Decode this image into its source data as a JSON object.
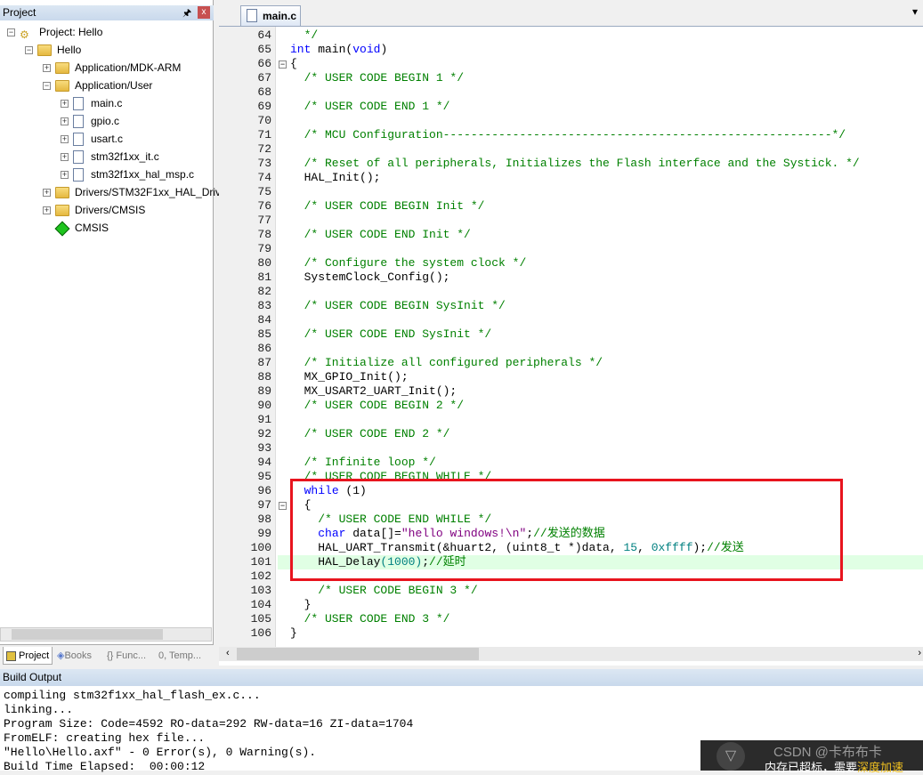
{
  "project_panel": {
    "title": "Project",
    "pin_icon": "pin-icon",
    "close_label": "x",
    "tree": [
      {
        "label": "Project: Hello",
        "level": 0,
        "icon": "project-icon",
        "expanded": true
      },
      {
        "label": "Hello",
        "level": 1,
        "icon": "folder-open-icon",
        "expanded": true
      },
      {
        "label": "Application/MDK-ARM",
        "level": 2,
        "icon": "folder-icon",
        "expanded": false
      },
      {
        "label": "Application/User",
        "level": 2,
        "icon": "folder-open-icon",
        "expanded": true
      },
      {
        "label": "main.c",
        "level": 3,
        "icon": "file-icon",
        "expanded": false
      },
      {
        "label": "gpio.c",
        "level": 3,
        "icon": "file-icon",
        "expanded": false
      },
      {
        "label": "usart.c",
        "level": 3,
        "icon": "file-icon",
        "expanded": false
      },
      {
        "label": "stm32f1xx_it.c",
        "level": 3,
        "icon": "file-icon",
        "expanded": false
      },
      {
        "label": "stm32f1xx_hal_msp.c",
        "level": 3,
        "icon": "file-icon",
        "expanded": false
      },
      {
        "label": "Drivers/STM32F1xx_HAL_Driver",
        "level": 2,
        "icon": "folder-icon",
        "expanded": false
      },
      {
        "label": "Drivers/CMSIS",
        "level": 2,
        "icon": "folder-icon",
        "expanded": false
      },
      {
        "label": "CMSIS",
        "level": 2,
        "icon": "cmsis-gem-icon",
        "expanded": null
      }
    ],
    "bottom_tabs": [
      {
        "label": "Project",
        "active": true
      },
      {
        "label": "Books"
      },
      {
        "label": "{} Func..."
      },
      {
        "label": "0, Temp..."
      }
    ]
  },
  "editor": {
    "tab": "main.c",
    "highlight_line": 101,
    "lines": [
      {
        "n": 64,
        "t": [
          [
            "cm",
            "  */"
          ]
        ]
      },
      {
        "n": 65,
        "t": [
          [
            "kw",
            "int"
          ],
          [
            "tx",
            " main("
          ],
          [
            "kw",
            "void"
          ],
          [
            "tx",
            ")"
          ]
        ]
      },
      {
        "n": 66,
        "fold": true,
        "t": [
          [
            "tx",
            "{"
          ]
        ]
      },
      {
        "n": 67,
        "t": [
          [
            "cm",
            "  /* USER CODE BEGIN 1 */"
          ]
        ]
      },
      {
        "n": 68,
        "t": []
      },
      {
        "n": 69,
        "t": [
          [
            "cm",
            "  /* USER CODE END 1 */"
          ]
        ]
      },
      {
        "n": 70,
        "t": []
      },
      {
        "n": 71,
        "t": [
          [
            "cm",
            "  /* MCU Configuration--------------------------------------------------------*/"
          ]
        ]
      },
      {
        "n": 72,
        "t": []
      },
      {
        "n": 73,
        "t": [
          [
            "cm",
            "  /* Reset of all peripherals, Initializes the Flash interface and the Systick. */"
          ]
        ]
      },
      {
        "n": 74,
        "t": [
          [
            "tx",
            "  HAL_Init();"
          ]
        ]
      },
      {
        "n": 75,
        "t": []
      },
      {
        "n": 76,
        "t": [
          [
            "cm",
            "  /* USER CODE BEGIN Init */"
          ]
        ]
      },
      {
        "n": 77,
        "t": []
      },
      {
        "n": 78,
        "t": [
          [
            "cm",
            "  /* USER CODE END Init */"
          ]
        ]
      },
      {
        "n": 79,
        "t": []
      },
      {
        "n": 80,
        "t": [
          [
            "cm",
            "  /* Configure the system clock */"
          ]
        ]
      },
      {
        "n": 81,
        "t": [
          [
            "tx",
            "  SystemClock_Config();"
          ]
        ]
      },
      {
        "n": 82,
        "t": []
      },
      {
        "n": 83,
        "t": [
          [
            "cm",
            "  /* USER CODE BEGIN SysInit */"
          ]
        ]
      },
      {
        "n": 84,
        "t": []
      },
      {
        "n": 85,
        "t": [
          [
            "cm",
            "  /* USER CODE END SysInit */"
          ]
        ]
      },
      {
        "n": 86,
        "t": []
      },
      {
        "n": 87,
        "t": [
          [
            "cm",
            "  /* Initialize all configured peripherals */"
          ]
        ]
      },
      {
        "n": 88,
        "t": [
          [
            "tx",
            "  MX_GPIO_Init();"
          ]
        ]
      },
      {
        "n": 89,
        "t": [
          [
            "tx",
            "  MX_USART2_UART_Init();"
          ]
        ]
      },
      {
        "n": 90,
        "t": [
          [
            "cm",
            "  /* USER CODE BEGIN 2 */"
          ]
        ]
      },
      {
        "n": 91,
        "t": []
      },
      {
        "n": 92,
        "t": [
          [
            "cm",
            "  /* USER CODE END 2 */"
          ]
        ]
      },
      {
        "n": 93,
        "t": []
      },
      {
        "n": 94,
        "t": [
          [
            "cm",
            "  /* Infinite loop */"
          ]
        ]
      },
      {
        "n": 95,
        "t": [
          [
            "cm",
            "  /* USER CODE BEGIN WHILE */"
          ]
        ]
      },
      {
        "n": 96,
        "t": [
          [
            "tx",
            "  "
          ],
          [
            "kw",
            "while"
          ],
          [
            "tx",
            " (1)"
          ]
        ]
      },
      {
        "n": 97,
        "fold": true,
        "t": [
          [
            "tx",
            "  {"
          ]
        ]
      },
      {
        "n": 98,
        "t": [
          [
            "cm",
            "    /* USER CODE END WHILE */"
          ]
        ]
      },
      {
        "n": 99,
        "t": [
          [
            "tx",
            "    "
          ],
          [
            "kw",
            "char"
          ],
          [
            "tx",
            " data[]="
          ],
          [
            "str",
            "\"hello windows!\\n\""
          ],
          [
            "tx",
            ";"
          ],
          [
            "cm",
            "//发送的数据"
          ]
        ]
      },
      {
        "n": 100,
        "t": [
          [
            "tx",
            "    HAL_UART_Transmit(&huart2, (uint8_t *)data, "
          ],
          [
            "num",
            "15"
          ],
          [
            "tx",
            ", "
          ],
          [
            "num",
            "0xffff"
          ],
          [
            "tx",
            ");"
          ],
          [
            "cm",
            "//发送"
          ]
        ]
      },
      {
        "n": 101,
        "t": [
          [
            "tx",
            "    HAL_Delay"
          ],
          [
            "num",
            "(1000)"
          ],
          [
            "tx",
            ";"
          ],
          [
            "cm",
            "//延时"
          ]
        ]
      },
      {
        "n": 102,
        "t": []
      },
      {
        "n": 103,
        "t": [
          [
            "cm",
            "    /* USER CODE BEGIN 3 */"
          ]
        ]
      },
      {
        "n": 104,
        "t": [
          [
            "tx",
            "  }"
          ]
        ]
      },
      {
        "n": 105,
        "t": [
          [
            "cm",
            "  /* USER CODE END 3 */"
          ]
        ]
      },
      {
        "n": 106,
        "t": [
          [
            "tx",
            "}"
          ]
        ]
      }
    ]
  },
  "build_output": {
    "title": "Build Output",
    "lines": [
      "compiling stm32f1xx_hal_flash_ex.c...",
      "linking...",
      "Program Size: Code=4592 RO-data=292 RW-data=16 ZI-data=1704",
      "FromELF: creating hex file...",
      "\"Hello\\Hello.axf\" - 0 Error(s), 0 Warning(s).",
      "Build Time Elapsed:  00:00:12"
    ]
  },
  "watermark": {
    "text": "CSDN @卡布布卡",
    "notice": "内存已超标，需要",
    "notice_link": "深度加速"
  },
  "colors": {
    "keyword": "#0000ff",
    "comment": "#008000",
    "number": "#008080",
    "string": "#800080",
    "highlight": "#e0ffe4",
    "annotation_box": "#e8141e"
  }
}
